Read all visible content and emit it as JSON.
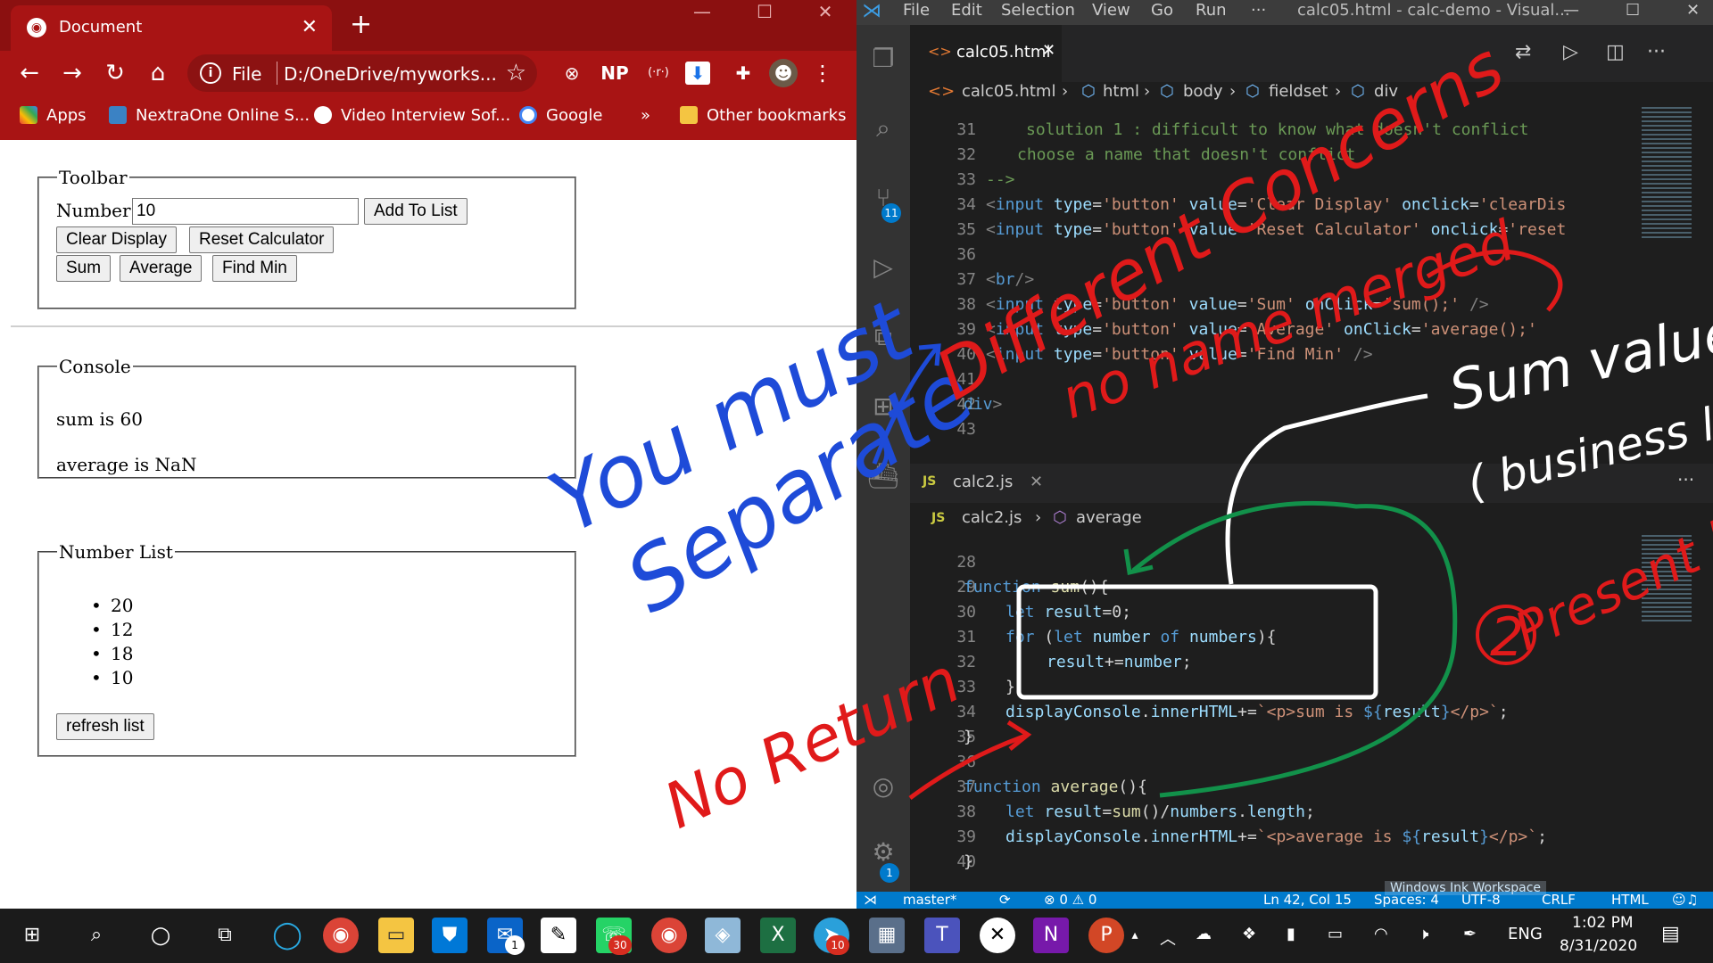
{
  "chrome": {
    "tab_title": "Document",
    "tab_close": "✕",
    "new_tab": "+",
    "scheme": "File",
    "url": "D:/OneDrive/myworks...",
    "ext_np": "NP",
    "ext_radio": "(·r·)",
    "bookmarks": [
      {
        "label": "Apps"
      },
      {
        "label": "NextraOne Online S..."
      },
      {
        "label": "Video Interview Sof..."
      },
      {
        "label": "Google"
      },
      {
        "label": "»"
      },
      {
        "label": "Other bookmarks"
      }
    ]
  },
  "page": {
    "toolbar": {
      "legend": "Toolbar",
      "number_label": "Number",
      "number_value": "10",
      "add_button": "Add To List",
      "clear_button": "Clear Display",
      "reset_button": "Reset Calculator",
      "sum_button": "Sum",
      "average_button": "Average",
      "findmin_button": "Find Min"
    },
    "console": {
      "legend": "Console",
      "lines": [
        "sum is 60",
        "average is NaN"
      ]
    },
    "number_list": {
      "legend": "Number List",
      "items": [
        "20",
        "12",
        "18",
        "10"
      ],
      "refresh_button": "refresh list"
    }
  },
  "vscode": {
    "menu": [
      "File",
      "Edit",
      "Selection",
      "View",
      "Go",
      "Run",
      "···"
    ],
    "title": "calc05.html - calc-demo - Visual...",
    "top_tab": "calc05.html",
    "top_breadcrumb": [
      "calc05.html",
      "html",
      "body",
      "fieldset",
      "div"
    ],
    "explorer_badge": "11",
    "settings_badge": "1",
    "bottom_tab": "calc2.js",
    "bottom_breadcrumb": [
      "calc2.js",
      "average"
    ],
    "status": {
      "branch": "master*",
      "problems": "⊗ 0 ⚠ 0",
      "position": "Ln 42, Col 15",
      "spaces": "Spaces: 4",
      "encoding": "UTF-8",
      "eol": "CRLF",
      "language": "HTML",
      "watermark": "Windows Ink Workspace"
    }
  },
  "taskbar": {
    "lang": "ENG",
    "time": "1:02 PM",
    "date": "8/31/2020",
    "mail_badge": "1",
    "whatsapp_badge": "30",
    "telegram_badge": "10"
  },
  "ink": {
    "you_must": "You must",
    "separate": "Separate",
    "different_concerns": "Different Concerns",
    "no_name_merged": "no name merged",
    "sum_values": "Sum values",
    "business_logic": "( business logic )",
    "presentation_logic": "Present logic",
    "circled_two": "2",
    "no_return": "No Return"
  }
}
